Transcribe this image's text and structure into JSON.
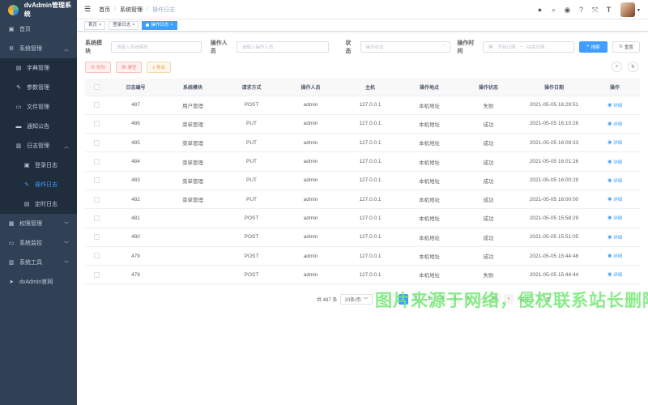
{
  "sidebar": {
    "logo_text": "dvAdmin管理系统",
    "items": [
      {
        "label": "首页",
        "icon": "dashboard-icon"
      },
      {
        "label": "系统管理",
        "icon": "gear-icon",
        "children": [
          {
            "label": "字典管理"
          },
          {
            "label": "参数管理"
          },
          {
            "label": "文件管理"
          },
          {
            "label": "通知公告"
          },
          {
            "label": "日志管理",
            "children": [
              {
                "label": "登录日志"
              },
              {
                "label": "操作日志"
              },
              {
                "label": "定时日志"
              }
            ]
          }
        ]
      },
      {
        "label": "权限管理"
      },
      {
        "label": "系统监控"
      },
      {
        "label": "系统工具"
      },
      {
        "label": "dvAdmin官网"
      }
    ]
  },
  "navbar": {
    "breadcrumb": [
      "首页",
      "系统管理",
      "操作日志"
    ],
    "size_label": "T"
  },
  "tags": [
    "首页",
    "登录日志",
    "操作日志"
  ],
  "filters": {
    "module_label": "系统模块",
    "module_placeholder": "请输入系统模块",
    "operator_label": "操作人员",
    "operator_placeholder": "请输入操作人员",
    "status_label": "状态",
    "status_placeholder": "操作状态",
    "time_label": "操作时间",
    "start_placeholder": "开始日期",
    "range_sep": "-",
    "end_placeholder": "结束日期",
    "search_btn": "搜索",
    "reset_btn": "重置"
  },
  "actions": {
    "delete_btn": "删除",
    "clear_btn": "清空",
    "export_btn": "导出"
  },
  "table": {
    "headers": [
      "日志编号",
      "系统模块",
      "请求方式",
      "操作人员",
      "主机",
      "操作地点",
      "操作状态",
      "操作日期",
      "操作"
    ],
    "detail_label": "详细",
    "rows": [
      [
        "487",
        "用户管理",
        "POST",
        "admin",
        "127.0.0.1",
        "本机地址",
        "失败",
        "2021-05-05 16:29:51"
      ],
      [
        "486",
        "菜单管理",
        "PUT",
        "admin",
        "127.0.0.1",
        "本机地址",
        "成功",
        "2021-05-05 16:10:26"
      ],
      [
        "485",
        "菜单管理",
        "PUT",
        "admin",
        "127.0.0.1",
        "本机地址",
        "成功",
        "2021-05-05 16:09:33"
      ],
      [
        "484",
        "菜单管理",
        "PUT",
        "admin",
        "127.0.0.1",
        "本机地址",
        "成功",
        "2021-05-05 16:01:26"
      ],
      [
        "483",
        "菜单管理",
        "PUT",
        "admin",
        "127.0.0.1",
        "本机地址",
        "成功",
        "2021-05-05 16:00:29"
      ],
      [
        "482",
        "菜单管理",
        "PUT",
        "admin",
        "127.0.0.1",
        "本机地址",
        "成功",
        "2021-05-05 16:00:00"
      ],
      [
        "481",
        "",
        "POST",
        "admin",
        "127.0.0.1",
        "本机地址",
        "成功",
        "2021-05-05 15:58:29"
      ],
      [
        "480",
        "",
        "POST",
        "admin",
        "127.0.0.1",
        "本机地址",
        "成功",
        "2021-05-05 15:51:05"
      ],
      [
        "479",
        "",
        "POST",
        "admin",
        "127.0.0.1",
        "本机地址",
        "成功",
        "2021-05-05 15:44:48"
      ],
      [
        "478",
        "",
        "POST",
        "admin",
        "127.0.0.1",
        "本机地址",
        "失败",
        "2021-05-05 15:44:44"
      ]
    ]
  },
  "pagination": {
    "total_text": "共 487 条",
    "size_text": "10条/页",
    "pages": [
      "1",
      "2",
      "3",
      "4",
      "5",
      "6",
      "...",
      "49"
    ],
    "goto_text": "前往",
    "page_unit": "页"
  },
  "watermark": "图片来源于网络，侵权联系站长删除！"
}
